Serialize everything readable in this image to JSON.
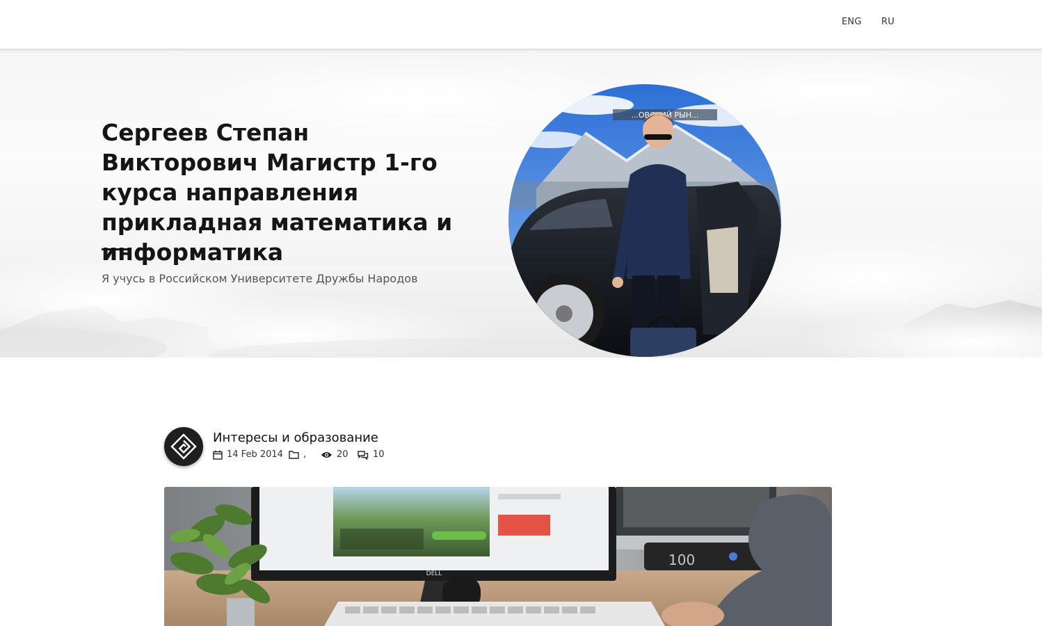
{
  "header": {
    "languages": [
      {
        "label": "ENG"
      },
      {
        "label": "RU"
      }
    ]
  },
  "hero": {
    "title": "Сергеев Степан Викторович Магистр 1-го курса направления прикладная математика и информатика",
    "subtitle": "Я учусь в Российском Университете Дружбы Народов",
    "photo_sign": "...ОВСКИЙ РЫН..."
  },
  "post": {
    "title": "Интересы и образование",
    "date": "14 Feb 2014",
    "category": ",",
    "views": "20",
    "comments": "10",
    "image_brand": "DELL"
  }
}
